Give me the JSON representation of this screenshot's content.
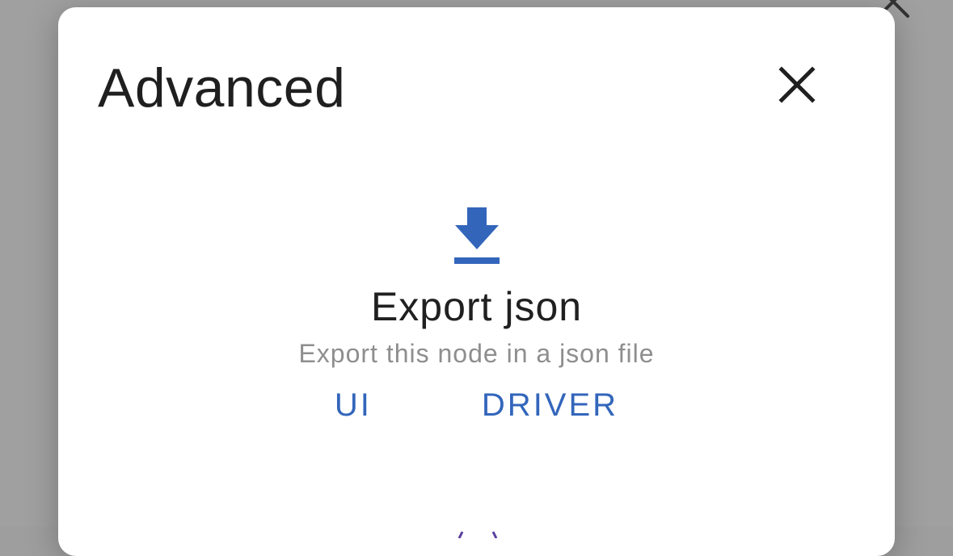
{
  "dialog": {
    "title": "Advanced",
    "close_icon": "close-icon"
  },
  "background": {
    "close_icon": "close-icon"
  },
  "export": {
    "icon": "download-icon",
    "title": "Export json",
    "description": "Export this node in a json file",
    "buttons": [
      {
        "label": "UI"
      },
      {
        "label": "DRIVER"
      }
    ]
  },
  "colors": {
    "accent": "#3366bb",
    "title_text": "#1f1f1f",
    "secondary_text": "#8e8e8e",
    "backdrop": "#a0a0a0",
    "surface": "#ffffff"
  }
}
